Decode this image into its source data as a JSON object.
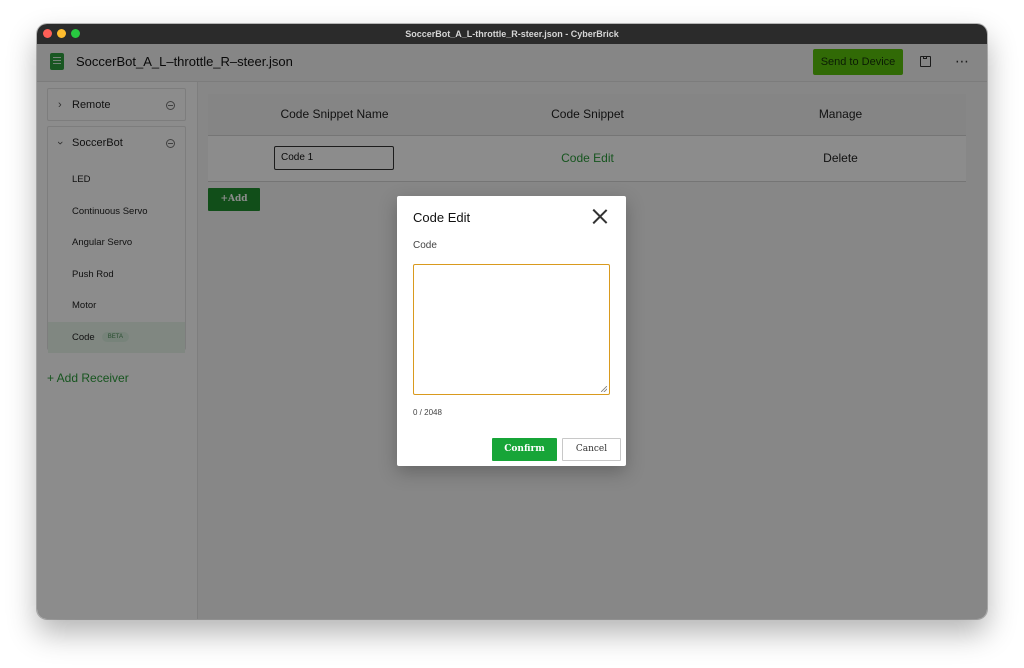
{
  "window": {
    "title": "SoccerBot_A_L-throttle_R-steer.json - CyberBrick"
  },
  "appbar": {
    "file_name": "SoccerBot_A_L–throttle_R–steer.json",
    "send_label": "Send to Device",
    "icons": [
      "file-icon",
      "save-icon",
      "more-icon"
    ]
  },
  "sidebar": {
    "remote_label": "Remote",
    "soccerbot_label": "SoccerBot",
    "items": [
      {
        "label": "LED"
      },
      {
        "label": "Continuous Servo"
      },
      {
        "label": "Angular Servo"
      },
      {
        "label": "Push Rod"
      },
      {
        "label": "Motor"
      },
      {
        "label": "Code",
        "badge": "BETA",
        "active": true
      }
    ],
    "add_receiver": "+ Add Receiver"
  },
  "table": {
    "headers": [
      "Code Snippet Name",
      "Code Snippet",
      "Manage"
    ],
    "rows": [
      {
        "name": "Code  1",
        "snippet": "Code Edit",
        "manage": "Delete"
      }
    ],
    "add_label": "+Add"
  },
  "modal": {
    "title": "Code Edit",
    "field_label": "Code",
    "value": "",
    "char_count": "0 / 2048",
    "confirm_label": "Confirm",
    "cancel_label": "Cancel"
  },
  "colors": {
    "accent_green": "#2a9b3a",
    "send_button": "#5ac20b",
    "confirm_button": "#17a538",
    "textarea_focus": "#d99a1e"
  }
}
